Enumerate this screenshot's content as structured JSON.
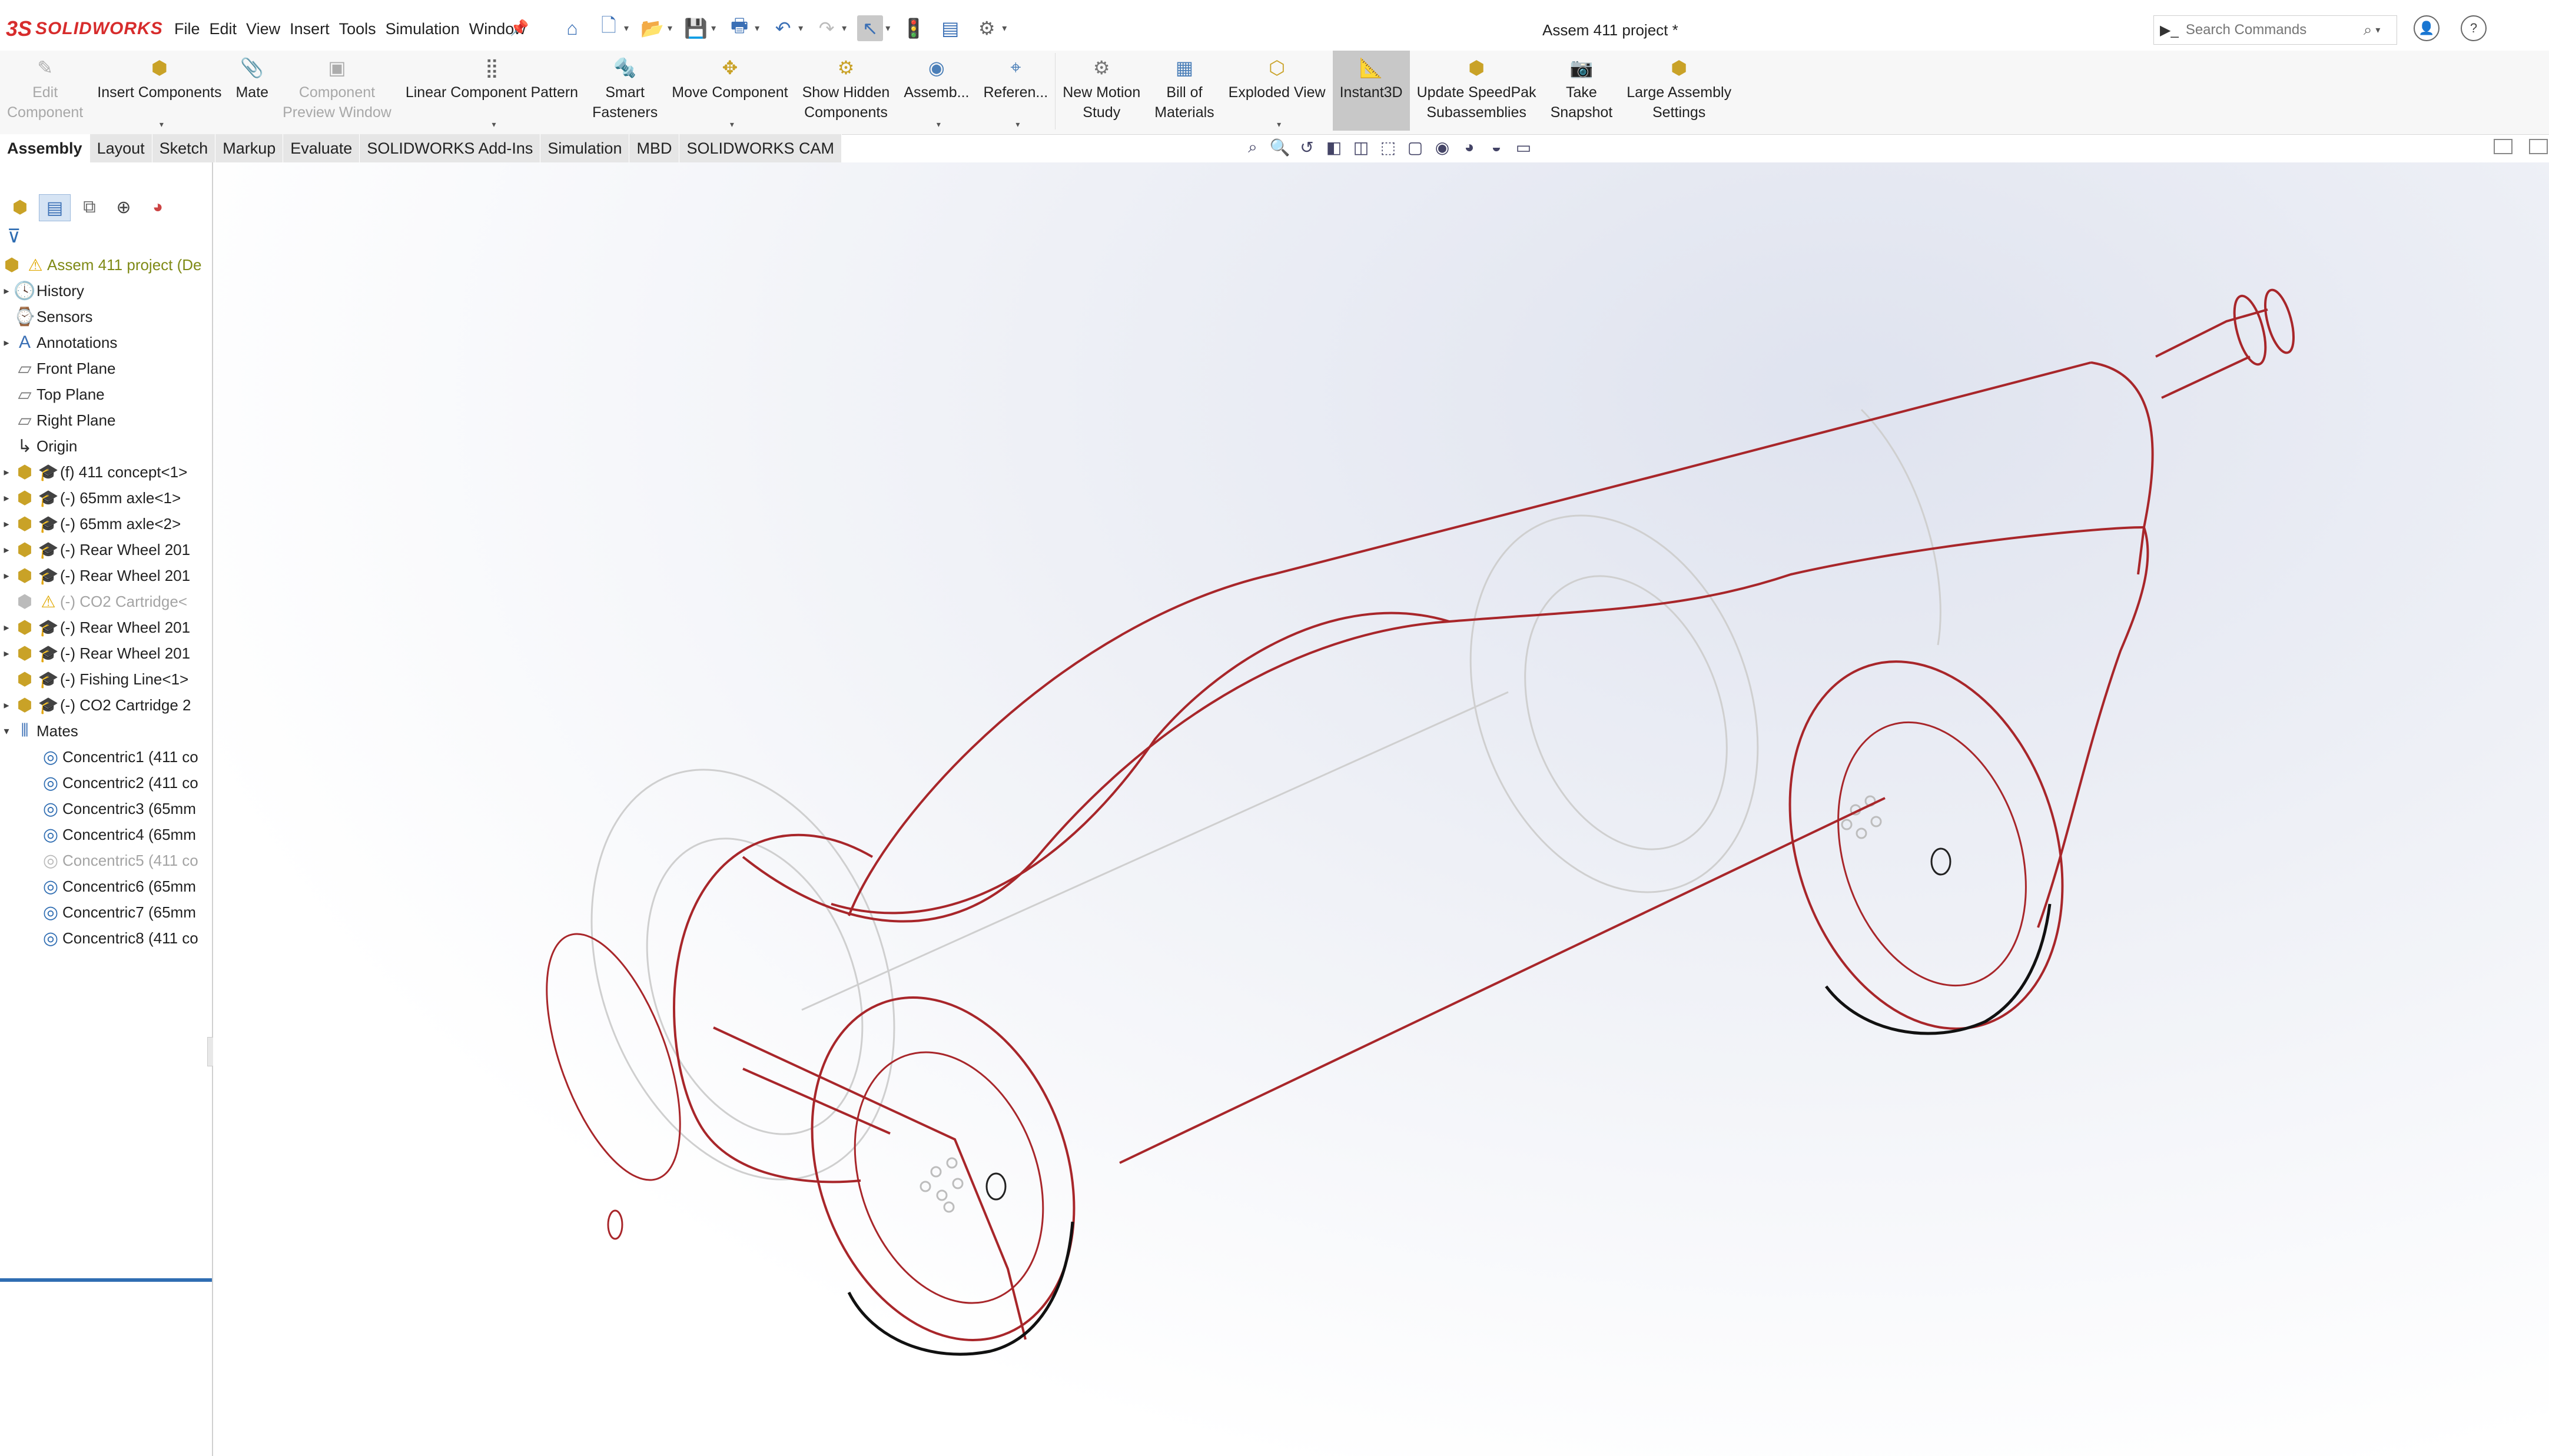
{
  "app": {
    "brand": "SOLIDWORKS",
    "document_title": "Assem 411 project *"
  },
  "menu": [
    "File",
    "Edit",
    "View",
    "Insert",
    "Tools",
    "Simulation",
    "Window"
  ],
  "search": {
    "placeholder": "Search Commands"
  },
  "commands": [
    {
      "label": "Edit\nComponent",
      "icon": "edit-component-icon",
      "disabled": true
    },
    {
      "label": "Insert Components",
      "icon": "insert-components-icon",
      "dropdown": true
    },
    {
      "label": "Mate",
      "icon": "mate-icon"
    },
    {
      "label": "Component\nPreview Window",
      "icon": "component-preview-icon",
      "disabled": true
    },
    {
      "label": "Linear Component Pattern",
      "icon": "linear-pattern-icon",
      "dropdown": true
    },
    {
      "label": "Smart\nFasteners",
      "icon": "smart-fasteners-icon"
    },
    {
      "label": "Move Component",
      "icon": "move-component-icon",
      "dropdown": true
    },
    {
      "label": "Show Hidden\nComponents",
      "icon": "show-hidden-icon"
    },
    {
      "label": "Assemb...",
      "icon": "assembly-features-icon",
      "dropdown": true
    },
    {
      "label": "Referen...",
      "icon": "reference-geometry-icon",
      "dropdown": true
    },
    {
      "label": "New Motion\nStudy",
      "icon": "motion-study-icon"
    },
    {
      "label": "Bill of\nMaterials",
      "icon": "bom-icon"
    },
    {
      "label": "Exploded View",
      "icon": "exploded-view-icon",
      "dropdown": true
    },
    {
      "label": "Instant3D",
      "icon": "instant3d-icon",
      "active": true
    },
    {
      "label": "Update SpeedPak\nSubassemblies",
      "icon": "speedpak-icon"
    },
    {
      "label": "Take\nSnapshot",
      "icon": "snapshot-icon"
    },
    {
      "label": "Large Assembly\nSettings",
      "icon": "large-assembly-icon"
    }
  ],
  "tabs": [
    "Assembly",
    "Layout",
    "Sketch",
    "Markup",
    "Evaluate",
    "SOLIDWORKS Add-Ins",
    "Simulation",
    "MBD",
    "SOLIDWORKS CAM"
  ],
  "active_tab": "Assembly",
  "tree": {
    "root": "Assem 411 project (De",
    "items": [
      {
        "label": "History",
        "arrow": true
      },
      {
        "label": "Sensors"
      },
      {
        "label": "Annotations",
        "arrow": true
      },
      {
        "label": "Front Plane"
      },
      {
        "label": "Top Plane"
      },
      {
        "label": "Right Plane"
      },
      {
        "label": "Origin"
      },
      {
        "label": "(f) 411 concept<1>",
        "arrow": true
      },
      {
        "label": "(-) 65mm axle<1>",
        "arrow": true
      },
      {
        "label": "(-) 65mm axle<2>",
        "arrow": true
      },
      {
        "label": "(-) Rear Wheel 201",
        "arrow": true
      },
      {
        "label": "(-) Rear Wheel 201",
        "arrow": true
      },
      {
        "label": "(-) CO2 Cartridge<",
        "dim": true
      },
      {
        "label": "(-) Rear Wheel 201",
        "arrow": true
      },
      {
        "label": "(-) Rear Wheel 201",
        "arrow": true
      },
      {
        "label": "(-) Fishing Line<1>"
      },
      {
        "label": "(-) CO2 Cartridge 2",
        "arrow": true
      },
      {
        "label": "Mates",
        "arrow": true
      }
    ],
    "mates": [
      {
        "label": "Concentric1 (411 co"
      },
      {
        "label": "Concentric2 (411 co"
      },
      {
        "label": "Concentric3 (65mm"
      },
      {
        "label": "Concentric4 (65mm"
      },
      {
        "label": "Concentric5 (411 co",
        "dim": true
      },
      {
        "label": "Concentric6 (65mm"
      },
      {
        "label": "Concentric7 (65mm"
      },
      {
        "label": "Concentric8 (411 co"
      }
    ]
  },
  "colors": {
    "brand_red": "#d72c2c",
    "edge_red": "#a8262a",
    "hidden_line": "#c9c9c9",
    "active_blue": "#2f6db2"
  }
}
